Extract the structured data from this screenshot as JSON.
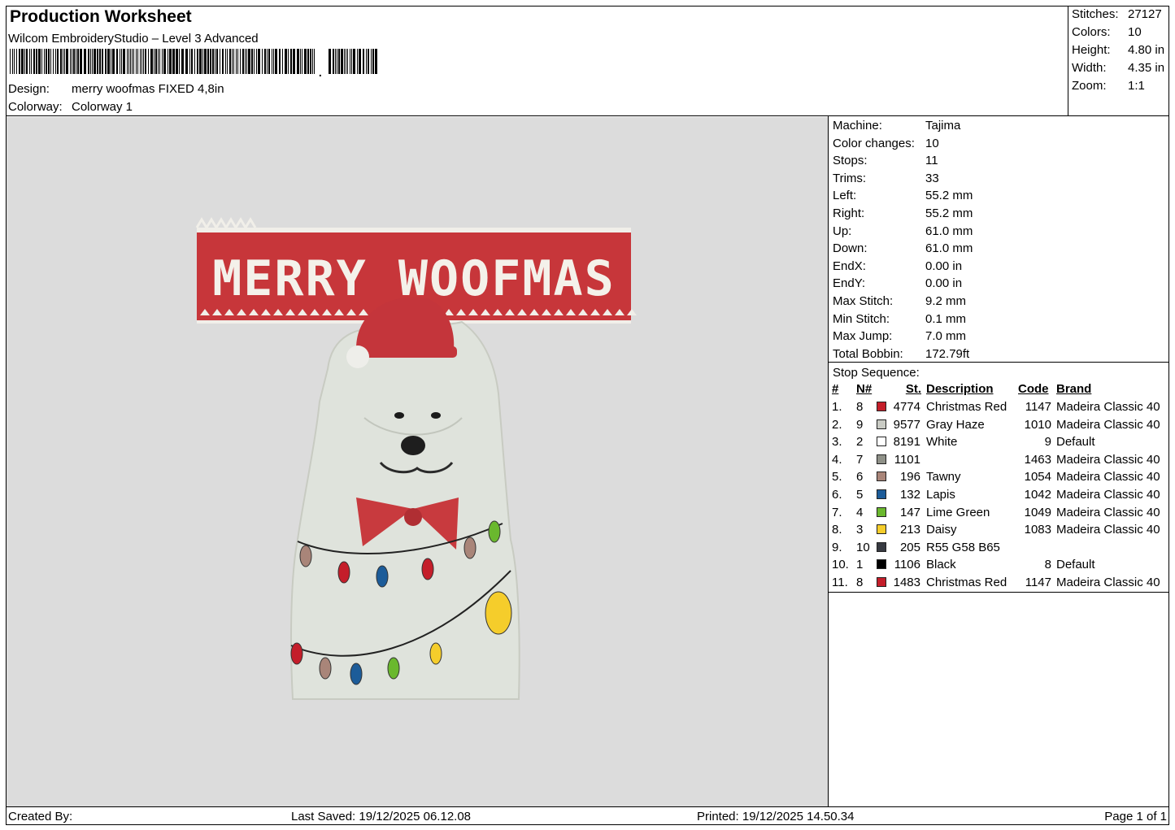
{
  "header": {
    "title": "Production Worksheet",
    "subtitle": "Wilcom EmbroideryStudio – Level 3 Advanced",
    "design_label": "Design:",
    "design_value": "merry woofmas FIXED 4,8in",
    "colorway_label": "Colorway:",
    "colorway_value": "Colorway 1"
  },
  "summary": [
    {
      "label": "Stitches:",
      "value": "27127"
    },
    {
      "label": "Colors:",
      "value": "10"
    },
    {
      "label": "Height:",
      "value": "4.80 in"
    },
    {
      "label": "Width:",
      "value": "4.35 in"
    },
    {
      "label": "Zoom:",
      "value": "1:1"
    }
  ],
  "details": [
    {
      "label": "Machine:",
      "value": "Tajima"
    },
    {
      "label": "Color changes:",
      "value": "10"
    },
    {
      "label": "Stops:",
      "value": "11"
    },
    {
      "label": "Trims:",
      "value": "33"
    },
    {
      "label": "Left:",
      "value": "55.2 mm"
    },
    {
      "label": "Right:",
      "value": "55.2 mm"
    },
    {
      "label": "Up:",
      "value": "61.0 mm"
    },
    {
      "label": "Down:",
      "value": "61.0 mm"
    },
    {
      "label": "EndX:",
      "value": "0.00 in"
    },
    {
      "label": "EndY:",
      "value": "0.00 in"
    },
    {
      "label": "Max Stitch:",
      "value": "9.2 mm"
    },
    {
      "label": "Min Stitch:",
      "value": "0.1 mm"
    },
    {
      "label": "Max Jump:",
      "value": "7.0 mm"
    },
    {
      "label": "Total Bobbin:",
      "value": "172.79ft"
    }
  ],
  "stop_sequence": {
    "title": "Stop Sequence:",
    "columns": [
      "#",
      "N#",
      "St.",
      "Description",
      "Code",
      "Brand"
    ],
    "rows": [
      {
        "idx": "1.",
        "n": "8",
        "color": "#c41e2a",
        "st": "4774",
        "desc": "Christmas Red",
        "code": "1147",
        "brand": "Madeira Classic 40"
      },
      {
        "idx": "2.",
        "n": "9",
        "color": "#c9cbc4",
        "st": "9577",
        "desc": "Gray Haze",
        "code": "1010",
        "brand": "Madeira Classic 40"
      },
      {
        "idx": "3.",
        "n": "2",
        "color": "#ffffff",
        "st": "8191",
        "desc": "White",
        "code": "9",
        "brand": "Default"
      },
      {
        "idx": "4.",
        "n": "7",
        "color": "#8f9188",
        "st": "1101",
        "desc": "",
        "code": "1463",
        "brand": "Madeira Classic 40"
      },
      {
        "idx": "5.",
        "n": "6",
        "color": "#a98579",
        "st": "196",
        "desc": "Tawny",
        "code": "1054",
        "brand": "Madeira Classic 40"
      },
      {
        "idx": "6.",
        "n": "5",
        "color": "#1c5c99",
        "st": "132",
        "desc": "Lapis",
        "code": "1042",
        "brand": "Madeira Classic 40"
      },
      {
        "idx": "7.",
        "n": "4",
        "color": "#6ab82e",
        "st": "147",
        "desc": "Lime Green",
        "code": "1049",
        "brand": "Madeira Classic 40"
      },
      {
        "idx": "8.",
        "n": "3",
        "color": "#f5cd2b",
        "st": "213",
        "desc": "Daisy",
        "code": "1083",
        "brand": "Madeira Classic 40"
      },
      {
        "idx": "9.",
        "n": "10",
        "color": "#373a41",
        "st": "205",
        "desc": "R55 G58 B65",
        "code": "",
        "brand": ""
      },
      {
        "idx": "10.",
        "n": "1",
        "color": "#000000",
        "st": "1106",
        "desc": "Black",
        "code": "8",
        "brand": "Default"
      },
      {
        "idx": "11.",
        "n": "8",
        "color": "#c41e2a",
        "st": "1483",
        "desc": "Christmas Red",
        "code": "1147",
        "brand": "Madeira Classic 40"
      }
    ]
  },
  "design": {
    "banner_text": "MERRY WOOFMAS",
    "banner_color": "#c7363a",
    "fur_color": "#dfe3dc"
  },
  "footer": {
    "created_by": "Created By:",
    "last_saved": "Last Saved: 19/12/2025 06.12.08",
    "printed": "Printed: 19/12/2025 14.50.34",
    "page": "Page 1 of 1"
  }
}
